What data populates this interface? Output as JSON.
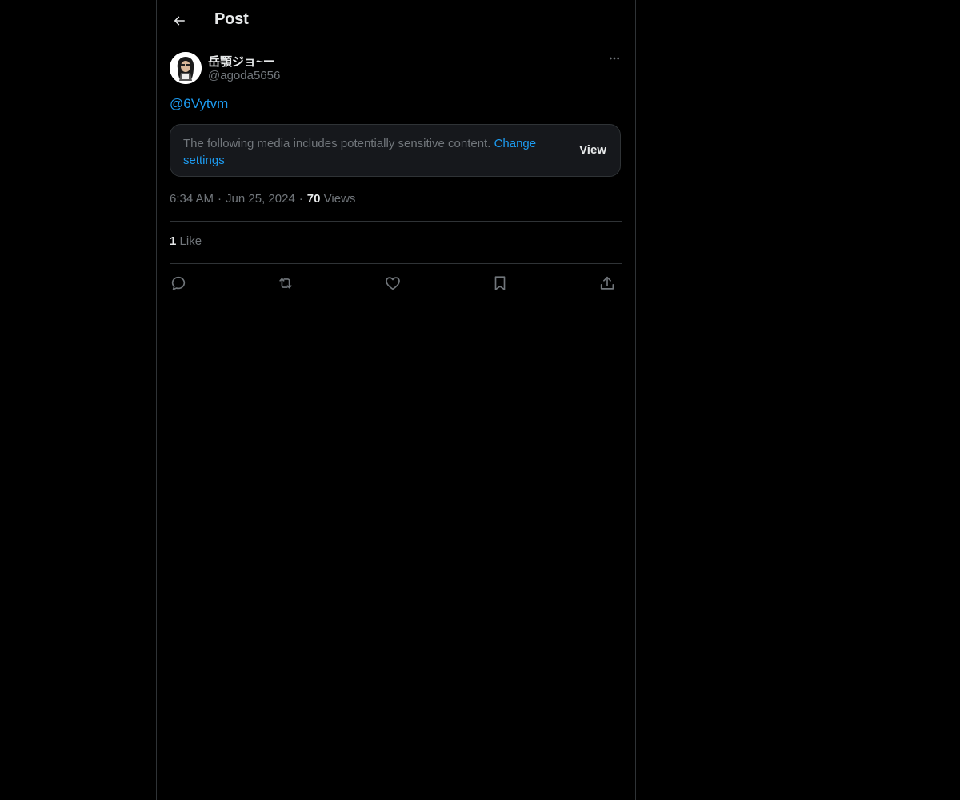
{
  "header": {
    "title": "Post",
    "back_icon": "arrow-left-icon"
  },
  "post": {
    "author": {
      "name": "岳顎ジョ~ー",
      "handle": "@agoda5656"
    },
    "more_icon": "more-horizontal-icon",
    "text": "@6Vytvm",
    "sensitive_notice": {
      "message": "The following media includes potentially sensitive content.",
      "change_link": "Change settings",
      "view_label": "View"
    },
    "meta": {
      "time": "6:34 AM",
      "separator": "·",
      "date": "Jun 25, 2024",
      "views_count": "70",
      "views_label": "Views"
    },
    "likes": {
      "count": "1",
      "label": "Like"
    },
    "actions": [
      {
        "name": "reply",
        "icon": "reply-icon"
      },
      {
        "name": "repost",
        "icon": "repost-icon"
      },
      {
        "name": "like",
        "icon": "heart-icon"
      },
      {
        "name": "bookmark",
        "icon": "bookmark-icon"
      },
      {
        "name": "share",
        "icon": "share-icon"
      }
    ]
  },
  "colors": {
    "background": "#000000",
    "border": "#2f3336",
    "text_primary": "#e7e9ea",
    "text_secondary": "#71767b",
    "accent": "#1d9bf0",
    "card": "#16181c"
  }
}
